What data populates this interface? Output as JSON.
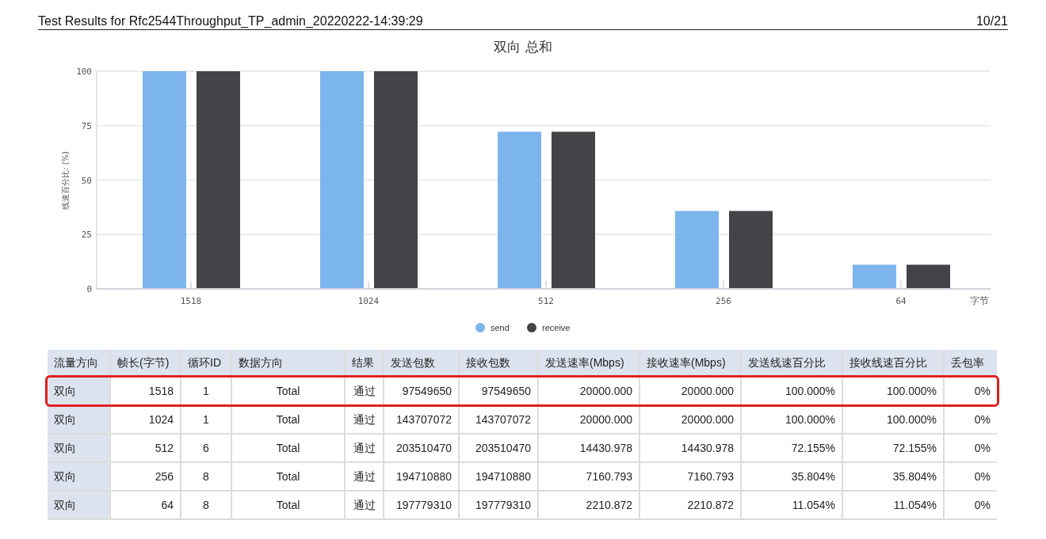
{
  "header": {
    "title": "Test Results for Rfc2544Throughput_TP_admin_20220222-14:39:29",
    "page": "10/21"
  },
  "chart": {
    "chart_data": {
      "type": "bar",
      "title": "双向 总和",
      "xlabel": "字节",
      "ylabel": "线速百分比: (%)",
      "categories": [
        "1518",
        "1024",
        "512",
        "256",
        "64"
      ],
      "ylim": [
        0,
        100
      ],
      "grid": true,
      "legend": true,
      "yticks": [
        0,
        25,
        50,
        75,
        100
      ],
      "series": [
        {
          "name": "send",
          "color": "#7cb5ec",
          "values": [
            100,
            100,
            72.2,
            35.8,
            11.1
          ]
        },
        {
          "name": "receive",
          "color": "#434348",
          "values": [
            100,
            100,
            72.2,
            35.8,
            11.1
          ]
        }
      ]
    }
  },
  "table": {
    "columns": [
      "流量方向",
      "帧长(字节)",
      "循环ID",
      "数据方向",
      "结果",
      "发送包数",
      "接收包数",
      "发送速率(Mbps)",
      "接收速率(Mbps)",
      "发送线速百分比",
      "接收线速百分比",
      "丢包率"
    ],
    "rows": [
      {
        "highlighted": true,
        "cells": [
          "双向",
          "1518",
          "1",
          "Total",
          "通过",
          "97549650",
          "97549650",
          "20000.000",
          "20000.000",
          "100.000%",
          "100.000%",
          "0%"
        ]
      },
      {
        "highlighted": false,
        "cells": [
          "双向",
          "1024",
          "1",
          "Total",
          "通过",
          "143707072",
          "143707072",
          "20000.000",
          "20000.000",
          "100.000%",
          "100.000%",
          "0%"
        ]
      },
      {
        "highlighted": false,
        "cells": [
          "双向",
          "512",
          "6",
          "Total",
          "通过",
          "203510470",
          "203510470",
          "14430.978",
          "14430.978",
          "72.155%",
          "72.155%",
          "0%"
        ]
      },
      {
        "highlighted": false,
        "cells": [
          "双向",
          "256",
          "8",
          "Total",
          "通过",
          "194710880",
          "194710880",
          "7160.793",
          "7160.793",
          "35.804%",
          "35.804%",
          "0%"
        ]
      },
      {
        "highlighted": false,
        "cells": [
          "双向",
          "64",
          "8",
          "Total",
          "通过",
          "197779310",
          "197779310",
          "2210.872",
          "2210.872",
          "11.054%",
          "11.054%",
          "0%"
        ]
      }
    ]
  }
}
